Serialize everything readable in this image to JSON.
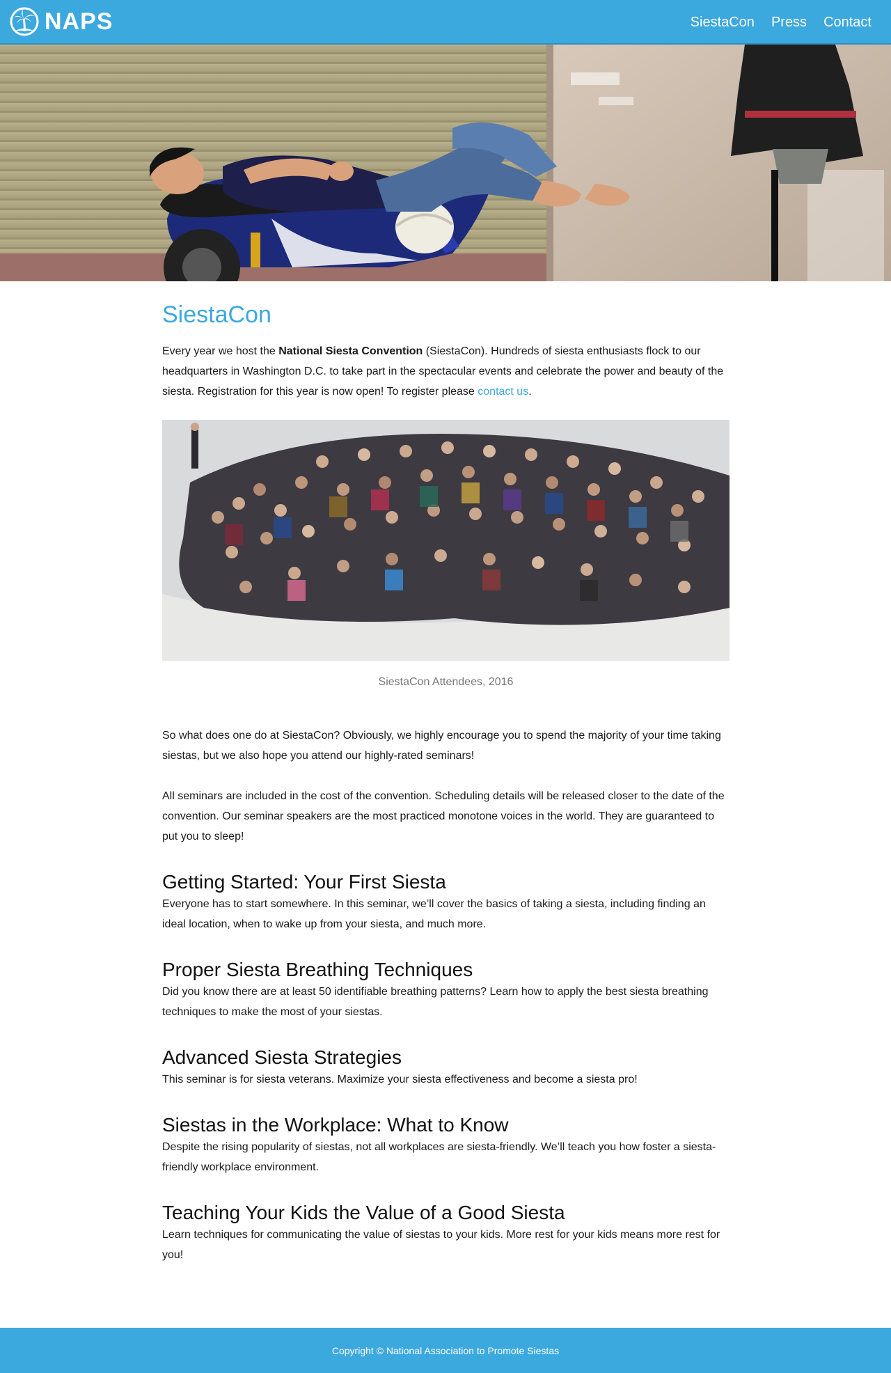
{
  "brand": {
    "name": "NAPS",
    "logo_icon": "palm-tree-icon",
    "colors": {
      "primary": "#3ba8de",
      "text": "#1a1a1a",
      "caption": "#777777"
    }
  },
  "nav": {
    "items": [
      {
        "label": "SiestaCon"
      },
      {
        "label": "Press"
      },
      {
        "label": "Contact"
      }
    ]
  },
  "hero": {
    "image": "man-sleeping-on-motorbike-photo"
  },
  "main": {
    "title": "SiestaCon",
    "intro": {
      "before_bold": "Every year we host the ",
      "bold": "National Siesta Convention",
      "after_bold": " (SiestaCon). Hundreds of siesta enthusiasts flock to our headquarters in Washington D.C. to take part in the spectacular events and celebrate the power and beauty of the siesta. Registration for this year is now open! To register please ",
      "link": "contact us",
      "end": "."
    },
    "figure": {
      "image": "siestacon-attendees-crowd-photo",
      "caption": "SiestaCon Attendees, 2016"
    },
    "paragraphs": [
      "So what does one do at SiestaCon? Obviously, we highly encourage you to spend the majority of your time taking siestas, but we also hope you attend our highly-rated seminars!",
      "All seminars are included in the cost of the convention. Scheduling details will be released closer to the date of the convention. Our seminar speakers are the most practiced monotone voices in the world. They are guaranteed to put you to sleep!"
    ],
    "seminars": [
      {
        "title": "Getting Started: Your First Siesta",
        "description": "Everyone has to start somewhere. In this seminar, we’ll cover the basics of taking a siesta, including finding an ideal location, when to wake up from your siesta, and much more."
      },
      {
        "title": "Proper Siesta Breathing Techniques",
        "description": "Did you know there are at least 50 identifiable breathing patterns? Learn how to apply the best siesta breathing techniques to make the most of your siestas."
      },
      {
        "title": "Advanced Siesta Strategies",
        "description": "This seminar is for siesta veterans. Maximize your siesta effectiveness and become a siesta pro!"
      },
      {
        "title": "Siestas in the Workplace: What to Know",
        "description": "Despite the rising popularity of siestas, not all workplaces are siesta-friendly. We’ll teach you how foster a siesta-friendly workplace environment."
      },
      {
        "title": "Teaching Your Kids the Value of a Good Siesta",
        "description": "Learn techniques for communicating the value of siestas to your kids. More rest for your kids means more rest for you!"
      }
    ]
  },
  "footer": {
    "copyright": "Copyright © National Association to Promote Siestas"
  }
}
